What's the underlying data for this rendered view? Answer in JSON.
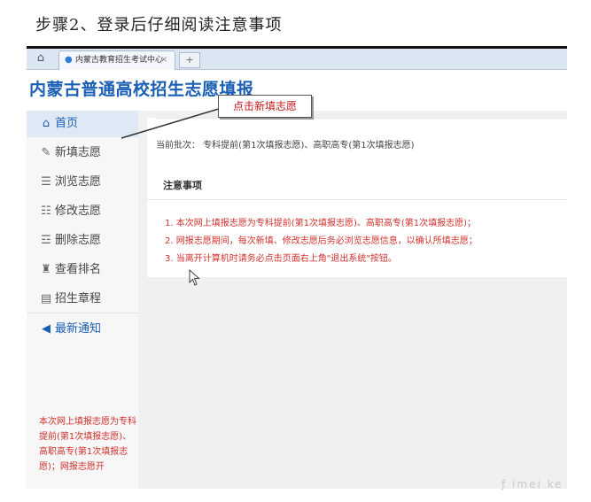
{
  "doc": {
    "step_heading": "步骤2、登录后仔细阅读注意事项",
    "watermark": "ƒ imei ke"
  },
  "browser": {
    "tab_title": "内蒙古教育招生考试中心",
    "tab_close": "×",
    "new_tab": "+"
  },
  "site": {
    "title": "内蒙古普通高校招生志愿填报"
  },
  "sidebar": {
    "items": [
      {
        "label": "首页",
        "icon": "home-icon",
        "active": true
      },
      {
        "label": "新填志愿",
        "icon": "edit-icon"
      },
      {
        "label": "浏览志愿",
        "icon": "list-icon"
      },
      {
        "label": "修改志愿",
        "icon": "edit-list-icon"
      },
      {
        "label": "删除志愿",
        "icon": "delete-list-icon"
      },
      {
        "label": "查看排名",
        "icon": "rank-icon"
      },
      {
        "label": "招生章程",
        "icon": "document-icon"
      }
    ],
    "notice_label": "最新通知",
    "marquee": "本次网上填报志愿为专科提前(第1次填报志愿)、高职高专(第1次填报志愿)；网报志愿开"
  },
  "main": {
    "batch_text": "当前批次：  专科提前(第1次填报志愿)、高职高专(第1次填报志愿)",
    "notice_title": "注意事项",
    "notice_items": [
      "1. 本次网上填报志愿为专科提前(第1次填报志愿)、高职高专(第1次填报志愿)；",
      "2. 网报志愿期间，每次新填、修改志愿后务必浏览志愿信息，以确认所填志愿；",
      "3. 当离开计算机时请务必点击页面右上角\"退出系统\"按钮。"
    ]
  },
  "annotation": {
    "callout": "点击新填志愿"
  },
  "colors": {
    "brand": "#1a5fb4",
    "warning": "#d0312d"
  }
}
